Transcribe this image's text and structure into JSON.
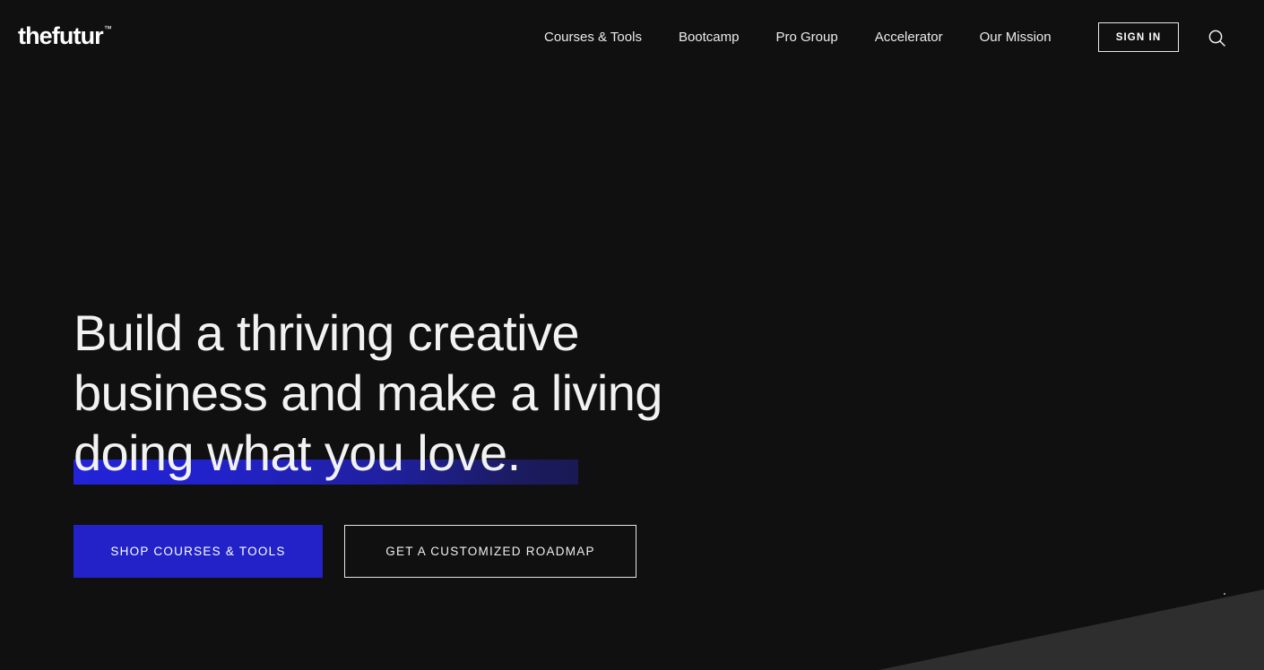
{
  "theme": {
    "background": "#101010",
    "text": "#f0f0f0",
    "accent_blue": "#2222c8",
    "highlight_from": "#2323d8",
    "highlight_to": "#191954",
    "wedge": "#2e2e2e"
  },
  "header": {
    "logo": {
      "wordmark": "thefutur",
      "trademark": "™"
    },
    "nav_items": [
      {
        "label": "Courses & Tools"
      },
      {
        "label": "Bootcamp"
      },
      {
        "label": "Pro Group"
      },
      {
        "label": "Accelerator"
      },
      {
        "label": "Our Mission"
      }
    ],
    "signin_label": "SIGN IN",
    "search_icon": "search-icon"
  },
  "hero": {
    "headline_lines": [
      "Build a thriving creative",
      "business and make a living",
      "doing what you love."
    ],
    "highlighted_line_index": 2,
    "cta": {
      "primary_label": "SHOP COURSES & TOOLS",
      "secondary_label": "GET A CUSTOMIZED ROADMAP"
    }
  }
}
